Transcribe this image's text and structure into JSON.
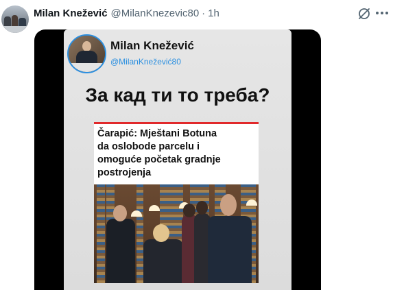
{
  "tweet": {
    "author": {
      "name": "Milan Knežević",
      "handle": "@MilanKnezevic80"
    },
    "separator": "·",
    "time": "1h"
  },
  "icons": {
    "grok": "grok-icon",
    "more": "more-icon"
  },
  "media": {
    "inner_post": {
      "name": "Milan Knežević",
      "handle": "@MilanKnežević80",
      "question": "За кад ти то треба?"
    },
    "article": {
      "headline_lines": [
        "Čarapić: Mještani Botuna",
        "da oslobode parcelu i",
        "omoguće početak gradnje",
        "postrojenja"
      ]
    }
  },
  "colors": {
    "accent_red": "#e1292b",
    "link_blue": "#2b8fe0"
  }
}
